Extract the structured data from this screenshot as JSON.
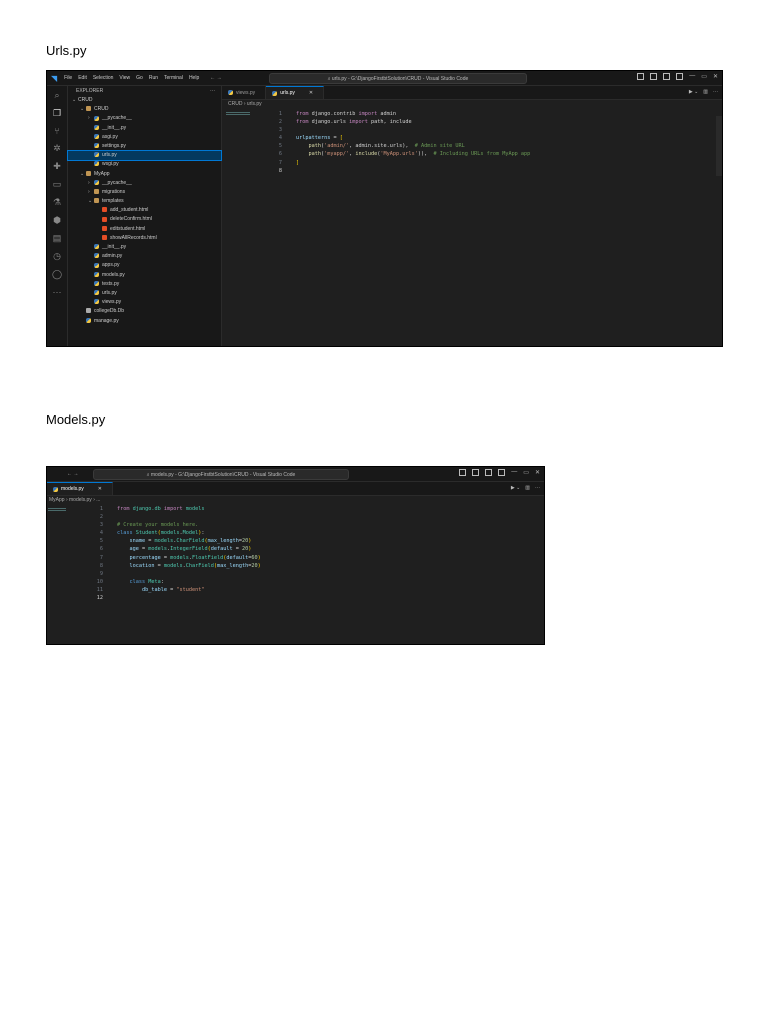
{
  "heading1": "Urls.py",
  "heading2": "Models.py",
  "win1": {
    "menu": [
      "File",
      "Edit",
      "Selection",
      "View",
      "Go",
      "Run",
      "Terminal",
      "Help"
    ],
    "title": "urls.py - G:\\DjangoFirstbtSolution\\CRUD - Visual Studio Code",
    "explorer_title": "EXPLORER",
    "tree": [
      {
        "label": "CRUD",
        "depth": 0,
        "chev": "v",
        "icon": ""
      },
      {
        "label": "CRUD",
        "depth": 1,
        "chev": "v",
        "icon": "folder"
      },
      {
        "label": "__pycache__",
        "depth": 2,
        "chev": ">",
        "icon": "py"
      },
      {
        "label": "__init__.py",
        "depth": 2,
        "chev": "",
        "icon": "py"
      },
      {
        "label": "asgi.py",
        "depth": 2,
        "chev": "",
        "icon": "py"
      },
      {
        "label": "settings.py",
        "depth": 2,
        "chev": "",
        "icon": "py"
      },
      {
        "label": "urls.py",
        "depth": 2,
        "chev": "",
        "icon": "py",
        "selected": true
      },
      {
        "label": "wsgi.py",
        "depth": 2,
        "chev": "",
        "icon": "py"
      },
      {
        "label": "MyApp",
        "depth": 1,
        "chev": "v",
        "icon": "folder"
      },
      {
        "label": "__pycache__",
        "depth": 2,
        "chev": ">",
        "icon": "py"
      },
      {
        "label": "migrations",
        "depth": 2,
        "chev": ">",
        "icon": "folder"
      },
      {
        "label": "templates",
        "depth": 2,
        "chev": "v",
        "icon": "folder"
      },
      {
        "label": "add_student.html",
        "depth": 3,
        "chev": "",
        "icon": "html"
      },
      {
        "label": "deleteConfirm.html",
        "depth": 3,
        "chev": "",
        "icon": "html"
      },
      {
        "label": "editstudent.html",
        "depth": 3,
        "chev": "",
        "icon": "html"
      },
      {
        "label": "showAllRecords.html",
        "depth": 3,
        "chev": "",
        "icon": "html"
      },
      {
        "label": "__init__.py",
        "depth": 2,
        "chev": "",
        "icon": "py"
      },
      {
        "label": "admin.py",
        "depth": 2,
        "chev": "",
        "icon": "py"
      },
      {
        "label": "apps.py",
        "depth": 2,
        "chev": "",
        "icon": "py"
      },
      {
        "label": "models.py",
        "depth": 2,
        "chev": "",
        "icon": "py"
      },
      {
        "label": "tests.py",
        "depth": 2,
        "chev": "",
        "icon": "py"
      },
      {
        "label": "urls.py",
        "depth": 2,
        "chev": "",
        "icon": "py"
      },
      {
        "label": "views.py",
        "depth": 2,
        "chev": "",
        "icon": "py"
      },
      {
        "label": "collegeDb.Db",
        "depth": 1,
        "chev": "",
        "icon": "db"
      },
      {
        "label": "manage.py",
        "depth": 1,
        "chev": "",
        "icon": "py"
      }
    ],
    "tabs": [
      {
        "label": "views.py",
        "active": false
      },
      {
        "label": "urls.py",
        "active": true
      }
    ],
    "breadcrumb": [
      "CRUD",
      "urls.py"
    ],
    "code": [
      [
        [
          "from",
          "k"
        ],
        [
          " django.contrib ",
          "d"
        ],
        [
          "import",
          "k"
        ],
        [
          " admin",
          "d"
        ]
      ],
      [
        [
          "from",
          "k"
        ],
        [
          " django.urls ",
          "d"
        ],
        [
          "import",
          "k"
        ],
        [
          " path, include",
          "d"
        ]
      ],
      [],
      [
        [
          "urlpatterns",
          "v"
        ],
        [
          " = ",
          "d"
        ],
        [
          "[",
          "b"
        ]
      ],
      [
        [
          "    ",
          "d"
        ],
        [
          "path",
          "f"
        ],
        [
          "(",
          "d"
        ],
        [
          "'admin/'",
          "s"
        ],
        [
          ", admin.site.urls),  ",
          "d"
        ],
        [
          "# Admin site URL",
          "c"
        ]
      ],
      [
        [
          "    ",
          "d"
        ],
        [
          "path",
          "f"
        ],
        [
          "(",
          "d"
        ],
        [
          "'myapp/'",
          "s"
        ],
        [
          ", ",
          "d"
        ],
        [
          "include",
          "f"
        ],
        [
          "(",
          "d"
        ],
        [
          "'MyApp.urls'",
          "s"
        ],
        [
          ")),  ",
          "d"
        ],
        [
          "# Including URLs from MyApp app",
          "c"
        ]
      ],
      [
        [
          "]",
          "b"
        ]
      ],
      []
    ]
  },
  "win2": {
    "title": "models.py - G:\\DjangoFirstbtSolution\\CRUD - Visual Studio Code",
    "tabs": [
      {
        "label": "models.py",
        "active": true
      }
    ],
    "breadcrumb": [
      "MyApp",
      "models.py",
      "..."
    ],
    "code": [
      [
        [
          "from",
          "k"
        ],
        [
          " django.db ",
          "t"
        ],
        [
          "import",
          "k"
        ],
        [
          " models",
          "t"
        ]
      ],
      [],
      [
        [
          "# Create your models here.",
          "c"
        ]
      ],
      [
        [
          "class",
          "kb"
        ],
        [
          " ",
          "d"
        ],
        [
          "Student",
          "t"
        ],
        [
          "(",
          "b"
        ],
        [
          "models",
          "t"
        ],
        [
          ".",
          "d"
        ],
        [
          "Model",
          "t"
        ],
        [
          ")",
          "b"
        ],
        [
          ":",
          "d"
        ]
      ],
      [
        [
          "    sname",
          "v"
        ],
        [
          " = ",
          "d"
        ],
        [
          "models",
          "t"
        ],
        [
          ".",
          "d"
        ],
        [
          "CharField",
          "t"
        ],
        [
          "(",
          "b"
        ],
        [
          "max_length",
          "v"
        ],
        [
          "=",
          "d"
        ],
        [
          "20",
          "num"
        ],
        [
          ")",
          "b"
        ]
      ],
      [
        [
          "    age",
          "v"
        ],
        [
          " = ",
          "d"
        ],
        [
          "models",
          "t"
        ],
        [
          ".",
          "d"
        ],
        [
          "IntegerField",
          "t"
        ],
        [
          "(",
          "b"
        ],
        [
          "default",
          "v"
        ],
        [
          " = ",
          "d"
        ],
        [
          "20",
          "num"
        ],
        [
          ")",
          "b"
        ]
      ],
      [
        [
          "    percentage",
          "v"
        ],
        [
          " = ",
          "d"
        ],
        [
          "models",
          "t"
        ],
        [
          ".",
          "d"
        ],
        [
          "FloatField",
          "t"
        ],
        [
          "(",
          "b"
        ],
        [
          "default",
          "v"
        ],
        [
          "=",
          "d"
        ],
        [
          "60",
          "num"
        ],
        [
          ")",
          "b"
        ]
      ],
      [
        [
          "    location",
          "v"
        ],
        [
          " = ",
          "d"
        ],
        [
          "models",
          "t"
        ],
        [
          ".",
          "d"
        ],
        [
          "CharField",
          "t"
        ],
        [
          "(",
          "b"
        ],
        [
          "max_length",
          "v"
        ],
        [
          "=",
          "d"
        ],
        [
          "20",
          "num"
        ],
        [
          ")",
          "b"
        ]
      ],
      [],
      [
        [
          "    ",
          "d"
        ],
        [
          "class",
          "kb"
        ],
        [
          " ",
          "d"
        ],
        [
          "Meta",
          "t"
        ],
        [
          ":",
          "d"
        ]
      ],
      [
        [
          "        db_table",
          "v"
        ],
        [
          " = ",
          "d"
        ],
        [
          "\"student\"",
          "s"
        ]
      ],
      []
    ]
  }
}
